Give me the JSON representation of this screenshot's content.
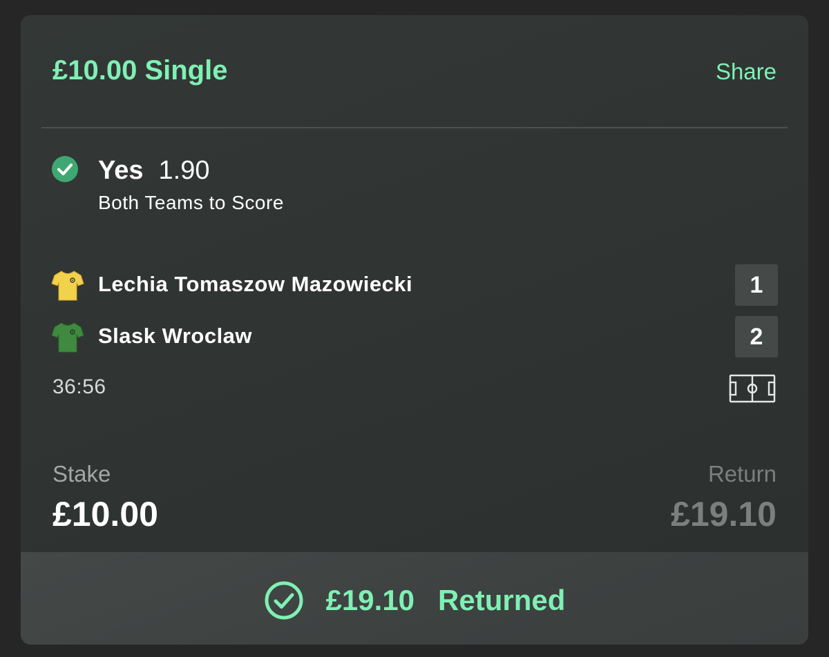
{
  "bet": {
    "title": "£10.00 Single",
    "share_label": "Share"
  },
  "selection": {
    "name": "Yes",
    "odds": "1.90",
    "market": "Both Teams to Score",
    "status_icon": "check-circle-icon"
  },
  "match": {
    "home": {
      "name": "Lechia Tomaszow Mazowiecki",
      "score": "1",
      "jersey_color": "#f2d24a"
    },
    "away": {
      "name": "Slask Wroclaw",
      "score": "2",
      "jersey_color": "#3f8a3f"
    },
    "time": "36:56",
    "pitch_icon": "football-pitch-icon"
  },
  "stake": {
    "label": "Stake",
    "value": "£10.00"
  },
  "return": {
    "label": "Return",
    "value": "£19.10"
  },
  "footer": {
    "amount": "£19.10",
    "status": "Returned"
  },
  "colors": {
    "accent": "#7ff0b4",
    "check_fill": "#3fa872",
    "card_bg": "#303432"
  }
}
